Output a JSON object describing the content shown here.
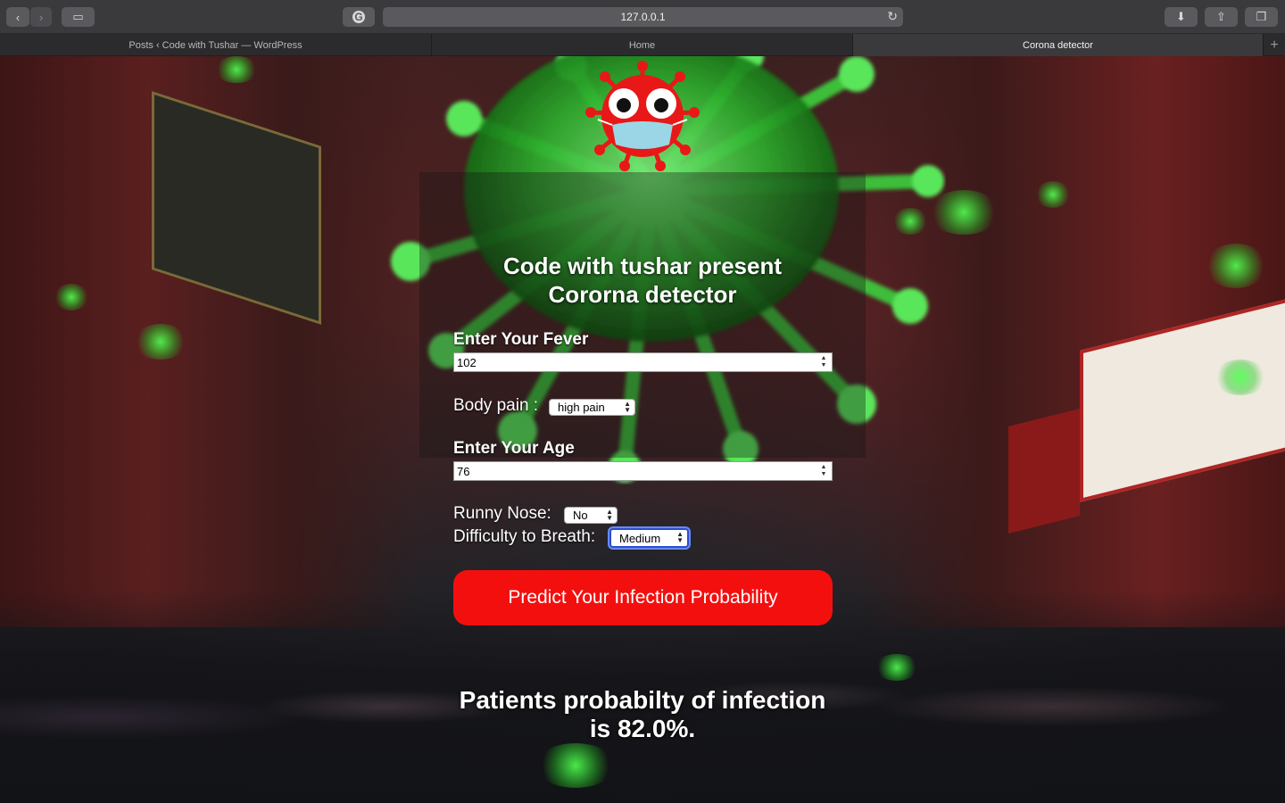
{
  "browser": {
    "url": "127.0.0.1",
    "tabs": [
      {
        "label": "Posts ‹ Code with Tushar — WordPress",
        "active": false
      },
      {
        "label": "Home",
        "active": false
      },
      {
        "label": "Corona detector",
        "active": true
      }
    ],
    "icons": {
      "back": "‹",
      "forward": "›",
      "sidebar": "▭",
      "extension": "G",
      "reload": "↻",
      "download": "⬇",
      "share": "⇧",
      "tabs": "❐",
      "new_tab": "+"
    }
  },
  "page": {
    "title_line1": "Code with tushar present",
    "title_line2": "Cororna detector",
    "fever": {
      "label": "Enter Your Fever",
      "value": "102"
    },
    "body_pain": {
      "label": "Body pain :",
      "value": "high pain"
    },
    "age": {
      "label": "Enter Your Age",
      "value": "76"
    },
    "runny_nose": {
      "label": "Runny Nose:",
      "value": "No"
    },
    "breath": {
      "label": "Difficulty to Breath:",
      "value": "Medium"
    },
    "predict_label": "Predict Your Infection Probability",
    "result_line1": "Patients probabilty of infection",
    "result_line2": "is 82.0%."
  },
  "colors": {
    "button_red": "#f40f0f",
    "virus_green": "#3cdc3c",
    "mascot_red": "#e81818"
  }
}
